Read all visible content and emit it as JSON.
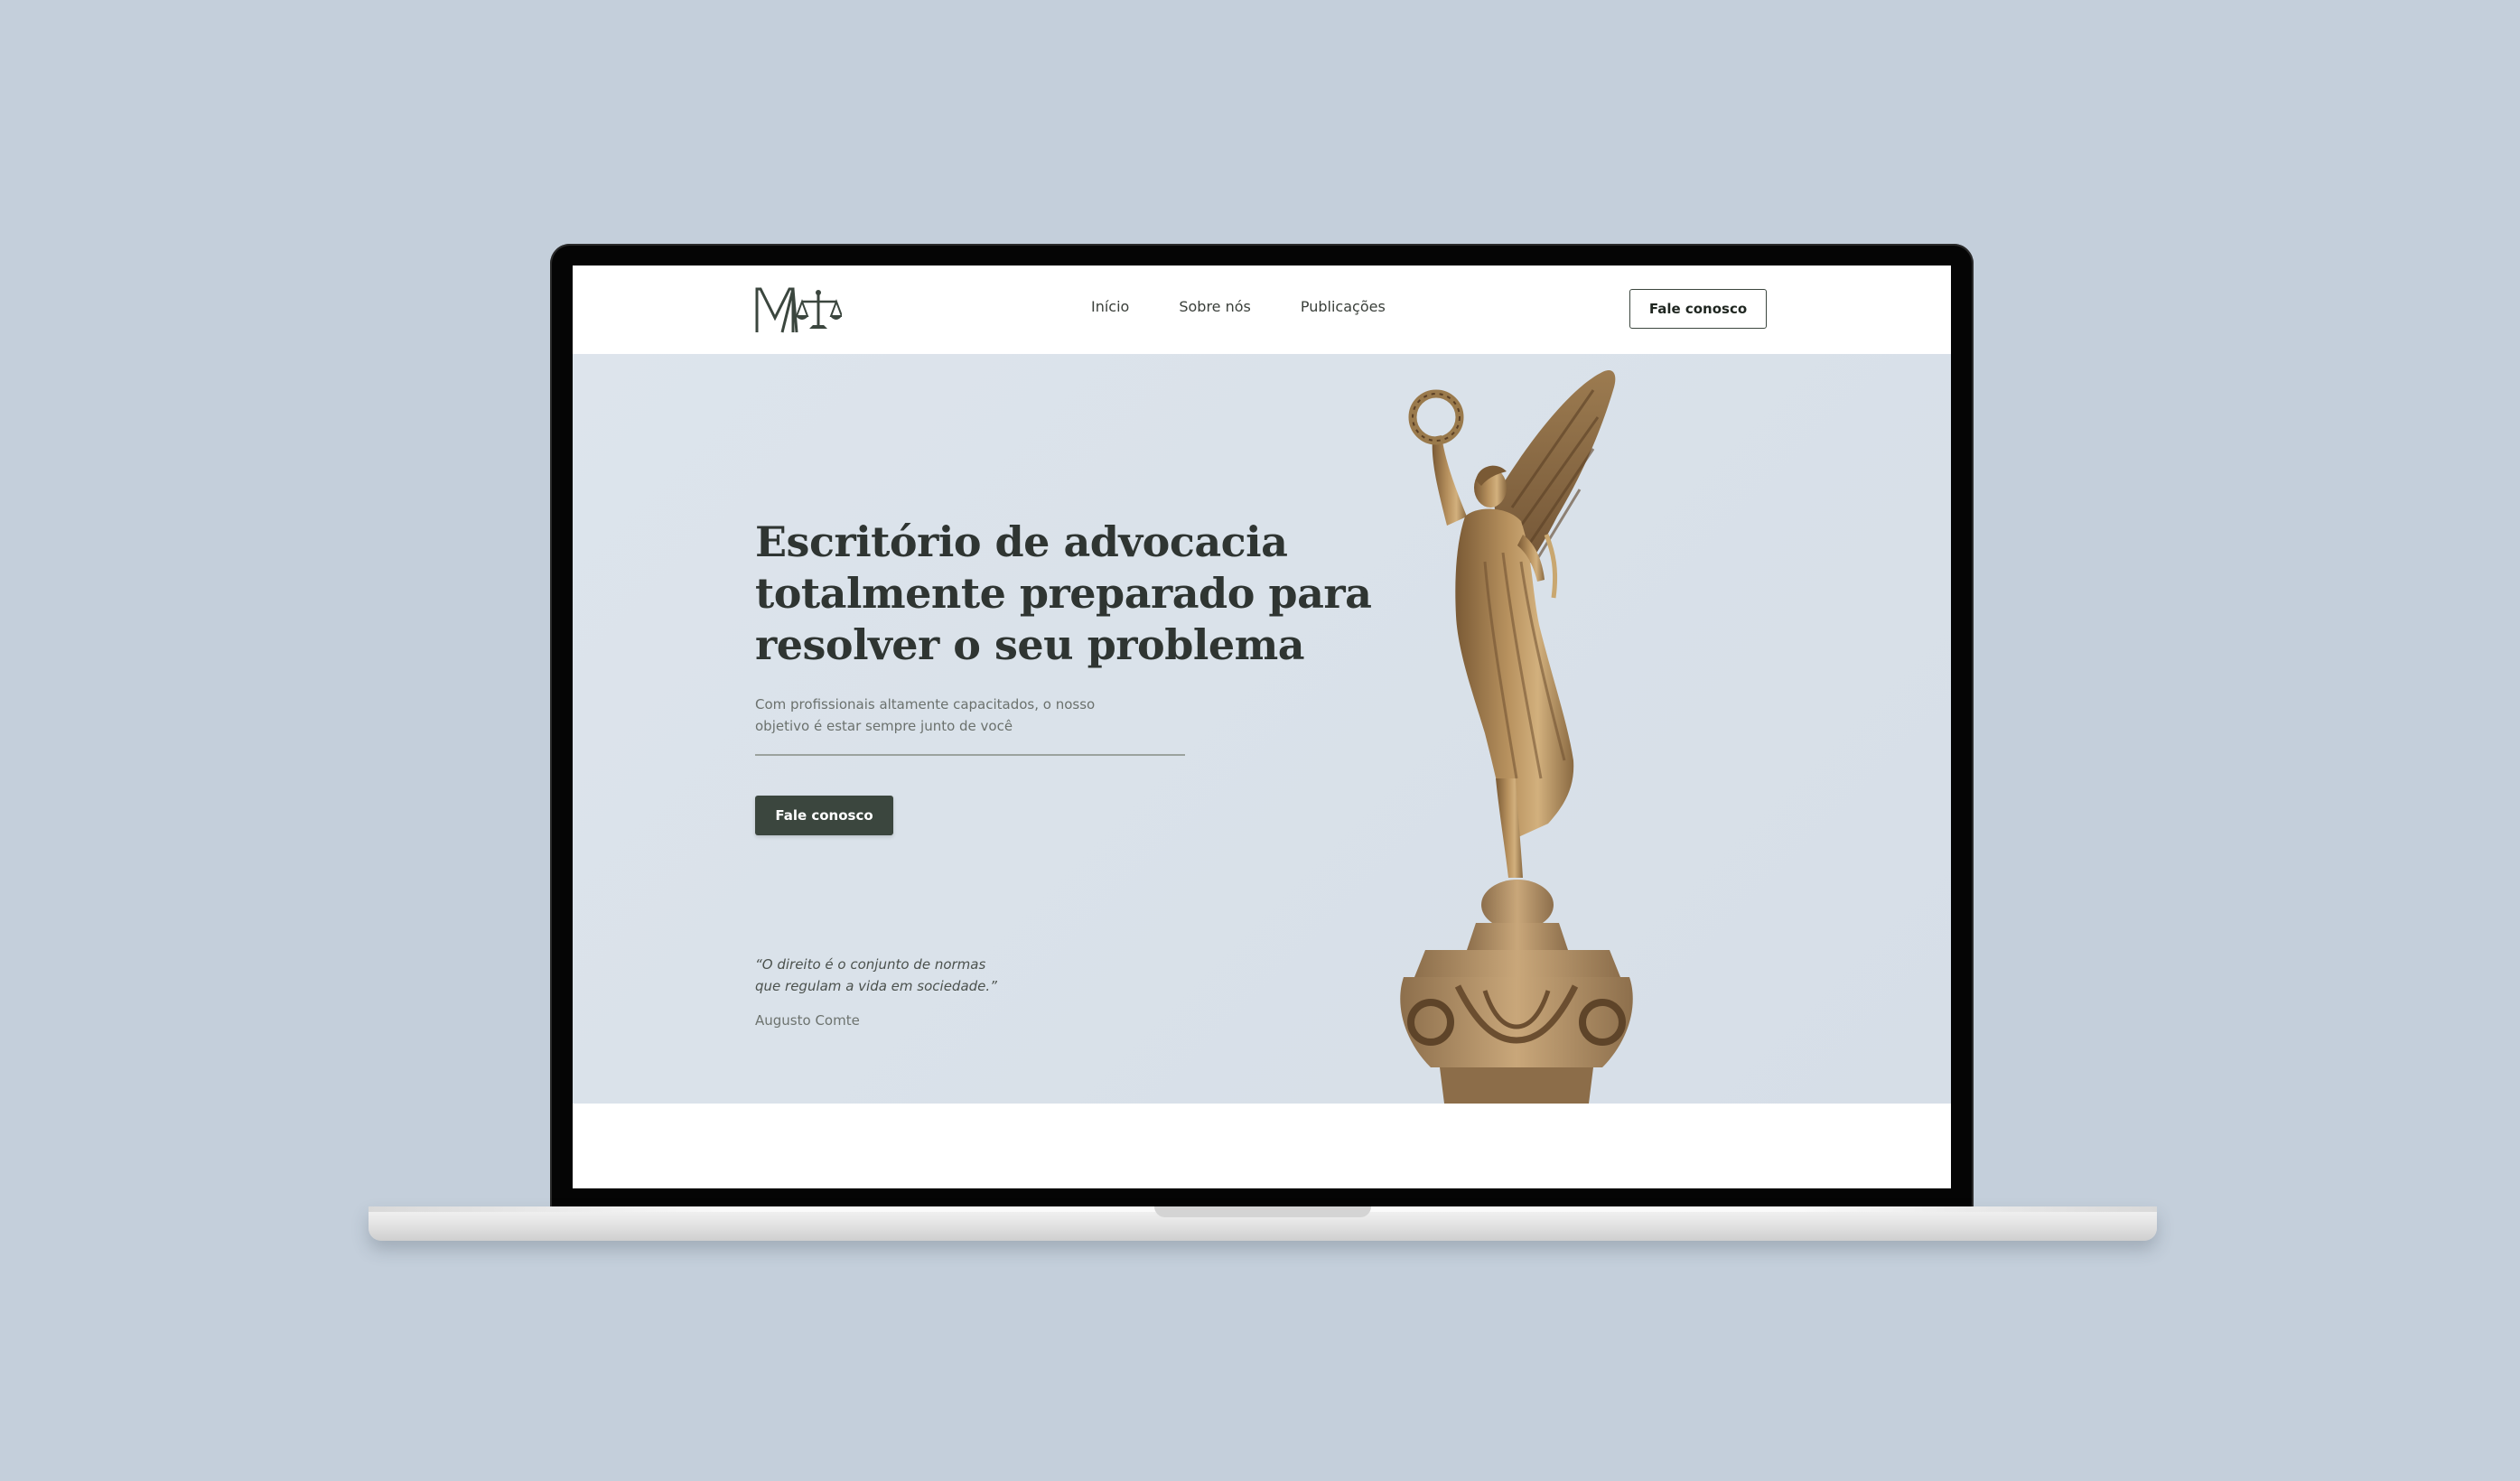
{
  "nav": {
    "items": [
      {
        "label": "Início"
      },
      {
        "label": "Sobre nós"
      },
      {
        "label": "Publicações"
      }
    ],
    "cta_label": "Fale conosco"
  },
  "hero": {
    "title_lines": [
      "Escritório de advocacia",
      "totalmente preparado para",
      "resolver o seu problema"
    ],
    "subtitle_lines": [
      "Com profissionais altamente capacitados, o nosso",
      "objetivo é estar sempre junto de você"
    ],
    "cta_label": "Fale conosco"
  },
  "quote": {
    "lines": [
      "“O direito é o conjunto de normas",
      "que regulam a vida em sociedade.”"
    ],
    "author": "Augusto Comte"
  },
  "colors": {
    "background": "#c4cfdb",
    "hero_bg": "#dae2ea",
    "primary_dark": "#3b463e",
    "title_text": "#2f3532",
    "bronze": "#a8865a"
  },
  "icons": {
    "logo": "ma-scales-logo",
    "statue": "winged-victory-statue"
  }
}
